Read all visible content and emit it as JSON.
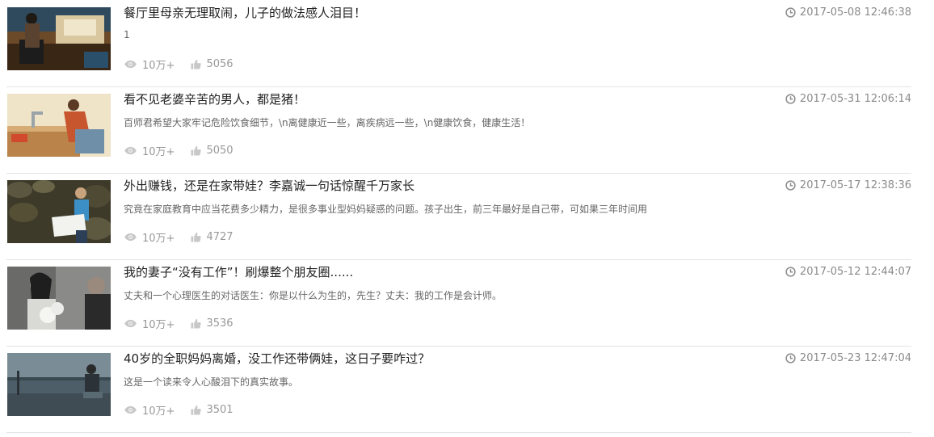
{
  "articles": [
    {
      "title": "餐厅里母亲无理取闹，儿子的做法感人泪目！",
      "summary": "1",
      "time": "2017-05-08 12:46:38",
      "views": "10万+",
      "likes": "5056",
      "thumb_icon": "restaurant-mother-photo"
    },
    {
      "title": "看不见老婆辛苦的男人，都是猪！",
      "summary": "百师君希望大家牢记危险饮食细节，\\n离健康近一些，离疾病远一些，\\n健康饮食，健康生活！",
      "time": "2017-05-31 12:06:14",
      "views": "10万+",
      "likes": "5050",
      "thumb_icon": "woman-kitchen-illustration"
    },
    {
      "title": "外出赚钱，还是在家带娃？李嘉诚一句话惊醒千万家长",
      "summary": "究竟在家庭教育中应当花费多少精力，是很多事业型妈妈疑惑的问题。孩子出生，前三年最好是自己带，可如果三年时间用",
      "time": "2017-05-17 12:38:36",
      "views": "10万+",
      "likes": "4727",
      "thumb_icon": "child-reading-photo"
    },
    {
      "title": "我的妻子“没有工作”！刷爆整个朋友圈......",
      "summary": "丈夫和一个心理医生的对话医生：你是以什么为生的，先生？丈夫：我的工作是会计师。",
      "time": "2017-05-12 12:44:07",
      "views": "10万+",
      "likes": "3536",
      "thumb_icon": "couple-flowers-photo"
    },
    {
      "title": "40岁的全职妈妈离婚，没工作还带俩娃，这日子要咋过？",
      "summary": "这是一个读来令人心酸泪下的真实故事。",
      "time": "2017-05-23 12:47:04",
      "views": "10万+",
      "likes": "3501",
      "thumb_icon": "woman-sitting-alone-photo"
    }
  ]
}
